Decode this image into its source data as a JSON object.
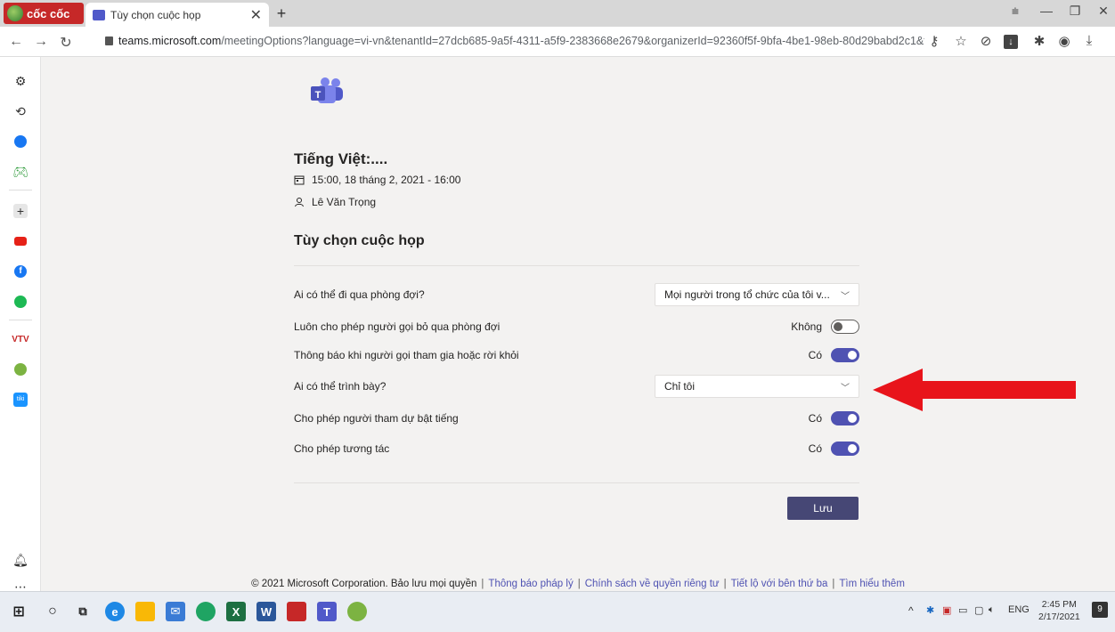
{
  "browser": {
    "logo_text": "cốc cốc",
    "tab_title": "Tùy chọn cuộc họp",
    "tab_close": "✕",
    "new_tab": "+",
    "url_domain": "teams.microsoft.com",
    "url_rest": "/meetingOptions?language=vi-vn&tenantId=27dcb685-9a5f-4311-a5f9-2383668e2679&organizerId=92360f5f-9bfa-4be1-98eb-80d29babd2c1&threadId=..."
  },
  "meeting": {
    "title": "Tiếng Việt:....",
    "datetime": "15:00, 18 tháng 2, 2021 - 16:00",
    "organizer": "Lê Văn Trọng"
  },
  "options": {
    "section_title": "Tùy chọn cuộc họp",
    "lobby_label": "Ai có thể đi qua phòng đợi?",
    "lobby_value": "Mọi người trong tổ chức của tôi v...",
    "bypass_label": "Luôn cho phép người gọi bỏ qua phòng đợi",
    "bypass_state": "Không",
    "notify_label": "Thông báo khi người gọi tham gia hoặc rời khỏi",
    "notify_state": "Có",
    "presenter_label": "Ai có thể trình bày?",
    "presenter_value": "Chỉ tôi",
    "unmute_label": "Cho phép người tham dự bật tiếng",
    "unmute_state": "Có",
    "interact_label": "Cho phép tương tác",
    "interact_state": "Có",
    "save_label": "Lưu"
  },
  "footer": {
    "copyright": "© 2021 Microsoft Corporation. Bảo lưu mọi quyền",
    "legal": "Thông báo pháp lý",
    "privacy": "Chính sách về quyền riêng tư",
    "third_party": "Tiết lộ với bên thứ ba",
    "learn_more": "Tìm hiểu thêm",
    "sep": "|"
  },
  "taskbar": {
    "lang": "ENG",
    "time": "2:45 PM",
    "date": "2/17/2021",
    "notif_count": "9"
  },
  "colors": {
    "accent": "#4f52b2",
    "save_button": "#464775",
    "arrow": "#e8141b"
  }
}
